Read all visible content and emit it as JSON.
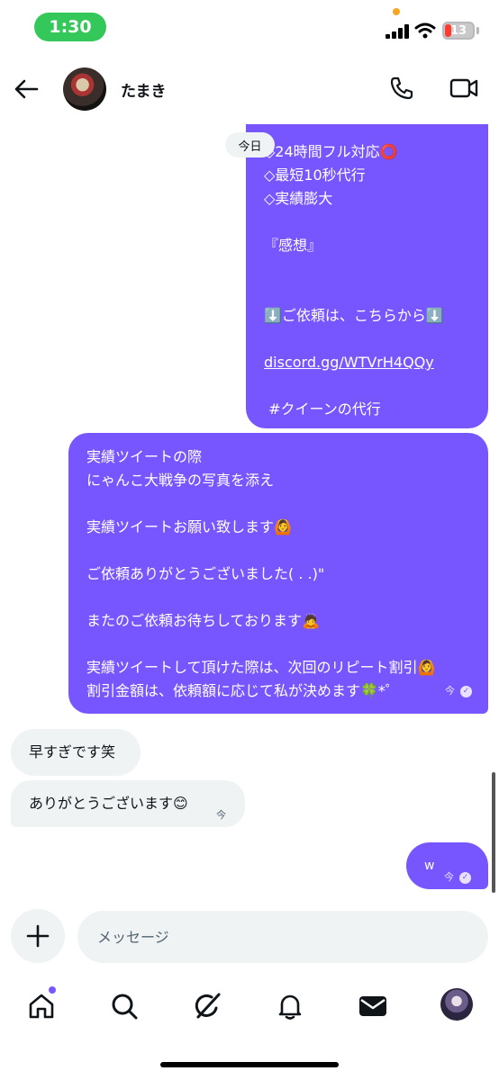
{
  "status_bar": {
    "time": "1:30",
    "battery": "13"
  },
  "header": {
    "contact_name": "たまき"
  },
  "date_chip": "今日",
  "messages": [
    {
      "from": "me",
      "lines": [
        "◇24時間フル対応⭕",
        "◇最短10秒代行",
        "◇実績膨大",
        "",
        "『感想』",
        "",
        "",
        "⬇️ご依頼は、こちらから⬇️",
        "",
        "discord.gg/WTVrH4QQy",
        "",
        " #クイーンの代行"
      ],
      "link": "discord.gg/WTVrH4QQy"
    },
    {
      "from": "me",
      "lines": [
        "実績ツイートの際",
        "にゃんこ大戦争の写真を添え",
        "",
        "実績ツイートお願い致します🙆",
        "",
        "ご依頼ありがとうございました( . .)\"",
        "",
        "またのご依頼お待ちしております🙇",
        "",
        "実績ツイートして頂けた際は、次回のリピート割引🙆",
        "割引金額は、依頼額に応じて私が決めます🍀*゜"
      ],
      "time": "今",
      "read": true
    },
    {
      "from": "them",
      "text": "早すぎです笑"
    },
    {
      "from": "them",
      "text": "ありがとうございます😊",
      "time": "今"
    },
    {
      "from": "me",
      "text": "w",
      "time": "今",
      "read": true
    }
  ],
  "composer": {
    "placeholder": "メッセージ"
  },
  "nav": {
    "items": [
      {
        "name": "home",
        "icon": "home-icon",
        "has_dot": true
      },
      {
        "name": "search",
        "icon": "search-icon"
      },
      {
        "name": "grok",
        "icon": "grok-icon"
      },
      {
        "name": "notifications",
        "icon": "bell-icon"
      },
      {
        "name": "messages",
        "icon": "mail-icon"
      },
      {
        "name": "profile",
        "icon": "avatar"
      }
    ]
  },
  "colors": {
    "accent": "#7856ff",
    "incoming_bubble": "#eff3f4",
    "status_pill": "#34c759"
  }
}
